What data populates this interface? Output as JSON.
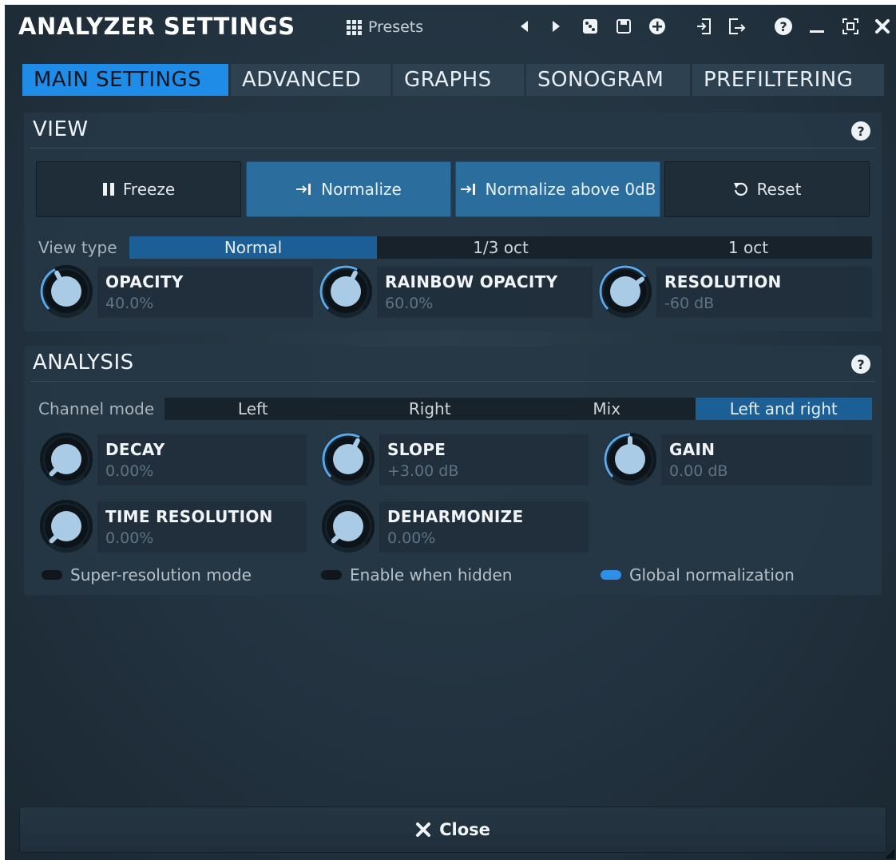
{
  "header": {
    "title": "ANALYZER SETTINGS",
    "presets_label": "Presets",
    "icons": [
      "prev-preset-icon",
      "next-preset-icon",
      "random-icon",
      "save-icon",
      "add-icon",
      "import-icon",
      "export-icon",
      "help-icon",
      "minimize-icon",
      "fit-icon",
      "close-icon"
    ]
  },
  "tabs": [
    {
      "label": "MAIN SETTINGS",
      "active": true
    },
    {
      "label": "ADVANCED",
      "active": false
    },
    {
      "label": "GRAPHS",
      "active": false
    },
    {
      "label": "SONOGRAM",
      "active": false
    },
    {
      "label": "PREFILTERING",
      "active": false
    }
  ],
  "view": {
    "title": "VIEW",
    "help": "?",
    "buttons": {
      "freeze": "Freeze",
      "normalize": "Normalize",
      "normalize_above": "Normalize above 0dB",
      "reset": "Reset"
    },
    "view_type": {
      "label": "View type",
      "options": [
        "Normal",
        "1/3 oct",
        "1 oct"
      ],
      "selected": "Normal"
    },
    "knobs": {
      "opacity": {
        "name": "OPACITY",
        "value": "40.0%",
        "level": 0.4
      },
      "rainbow_opacity": {
        "name": "RAINBOW OPACITY",
        "value": "60.0%",
        "level": 0.6
      },
      "resolution": {
        "name": "RESOLUTION",
        "value": "-60 dB",
        "level": 0.7
      }
    }
  },
  "analysis": {
    "title": "ANALYSIS",
    "help": "?",
    "channel_mode": {
      "label": "Channel mode",
      "options": [
        "Left",
        "Right",
        "Mix",
        "Left and right"
      ],
      "selected": "Left and right"
    },
    "knobs": {
      "decay": {
        "name": "DECAY",
        "value": "0.00%",
        "level": 0.0
      },
      "slope": {
        "name": "SLOPE",
        "value": "+3.00 dB",
        "level": 0.6
      },
      "gain": {
        "name": "GAIN",
        "value": "0.00 dB",
        "level": 0.5
      },
      "time_resolution": {
        "name": "TIME RESOLUTION",
        "value": "0.00%",
        "level": 0.0
      },
      "deharmonize": {
        "name": "DEHARMONIZE",
        "value": "0.00%",
        "level": 0.0
      }
    },
    "toggles": {
      "super_resolution": {
        "label": "Super-resolution mode",
        "on": false
      },
      "enable_hidden": {
        "label": "Enable when hidden",
        "on": false
      },
      "global_normalization": {
        "label": "Global normalization",
        "on": true
      }
    }
  },
  "footer": {
    "close_label": "Close"
  },
  "colors": {
    "accent": "#1f8ce8",
    "selected_segment": "#1c5e96",
    "active_button": "#2b6d9d",
    "knob_arc": "#58a9ec",
    "knob_cap": "#a9cbe6"
  }
}
